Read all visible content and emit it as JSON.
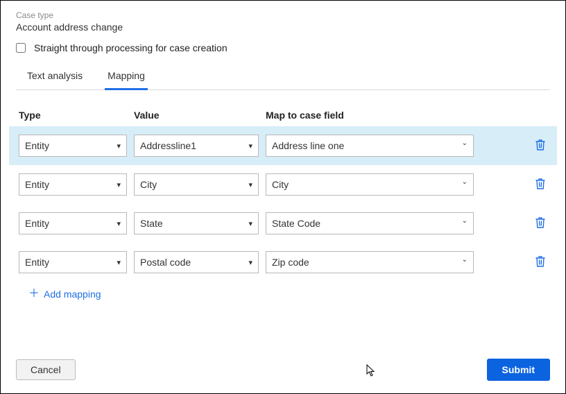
{
  "header": {
    "case_type_label": "Case type",
    "case_type_value": "Account address change",
    "stp_label": "Straight through processing for case creation",
    "stp_checked": false
  },
  "tabs": {
    "text_analysis": "Text analysis",
    "mapping": "Mapping",
    "active": "mapping"
  },
  "columns": {
    "type": "Type",
    "value": "Value",
    "map_to": "Map to case field"
  },
  "rows": [
    {
      "type": "Entity",
      "value": "Addressline1",
      "map_to": "Address line one",
      "highlight": true
    },
    {
      "type": "Entity",
      "value": "City",
      "map_to": "City",
      "highlight": false
    },
    {
      "type": "Entity",
      "value": "State",
      "map_to": "State Code",
      "highlight": false
    },
    {
      "type": "Entity",
      "value": "Postal code",
      "map_to": "Zip code",
      "highlight": false
    }
  ],
  "actions": {
    "add_mapping": "Add mapping",
    "cancel": "Cancel",
    "submit": "Submit"
  },
  "colors": {
    "accent": "#1f6fe5",
    "row_highlight": "#d7edf8",
    "submit_bg": "#0b63e0"
  }
}
